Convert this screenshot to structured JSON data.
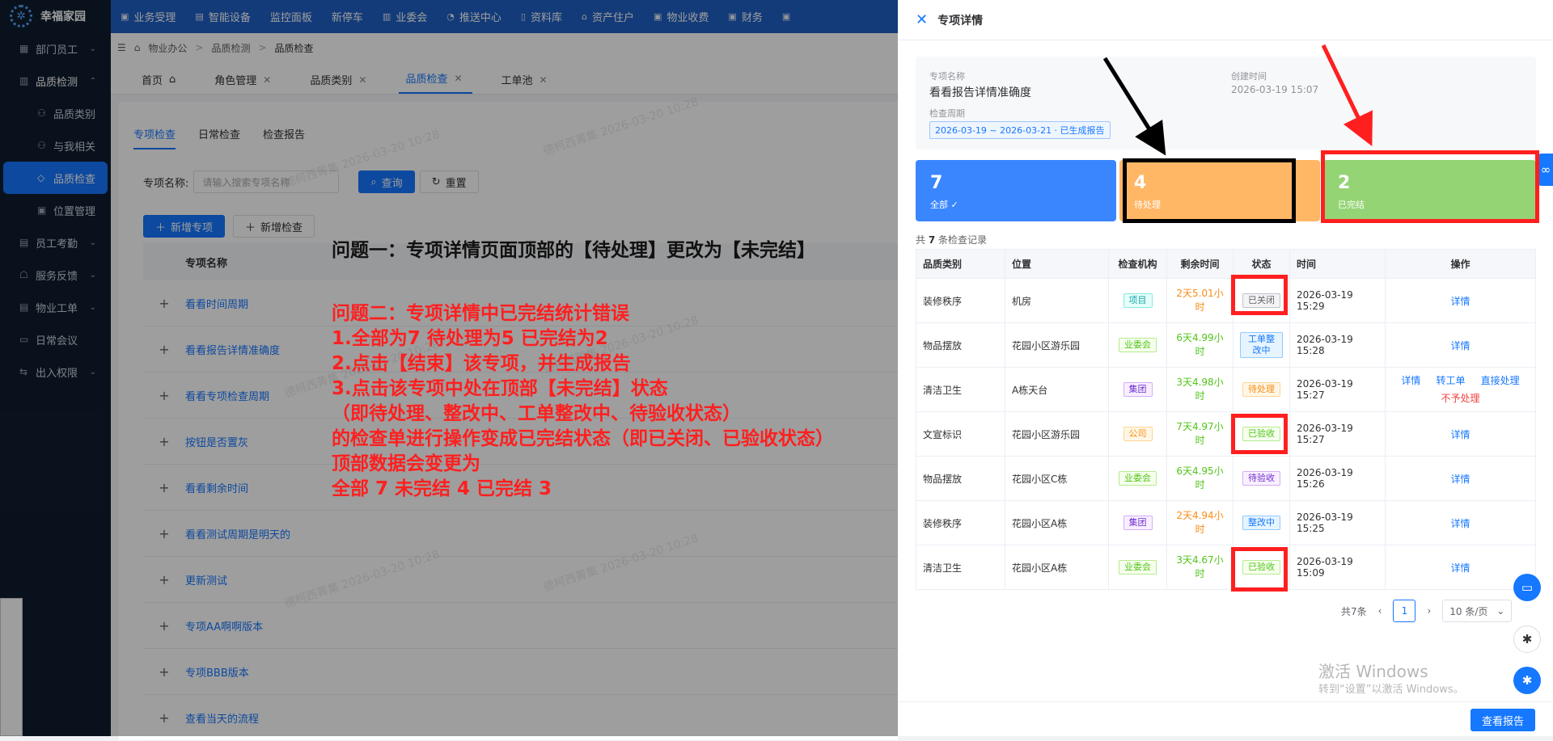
{
  "app": {
    "name": "幸福家园"
  },
  "sidebar": {
    "items": [
      {
        "icon": "department-icon",
        "label": "部门员工",
        "chev": "⌄"
      },
      {
        "icon": "quality-icon",
        "label": "品质检测",
        "chev": "⌃"
      },
      {
        "icon": "category-icon",
        "label": "品质类别"
      },
      {
        "icon": "related-icon",
        "label": "与我相关"
      },
      {
        "icon": "inspection-icon",
        "label": "品质检查"
      },
      {
        "icon": "location-icon",
        "label": "位置管理"
      },
      {
        "icon": "attendance-icon",
        "label": "员工考勤",
        "chev": "⌄"
      },
      {
        "icon": "feedback-icon",
        "label": "服务反馈",
        "chev": "⌄"
      },
      {
        "icon": "workorder-icon",
        "label": "物业工单",
        "chev": "⌄"
      },
      {
        "icon": "meeting-icon",
        "label": "日常会议"
      },
      {
        "icon": "access-icon",
        "label": "出入权限",
        "chev": "⌄"
      }
    ]
  },
  "topnav": [
    "业务受理",
    "智能设备",
    "监控面板",
    "新停车",
    "业委会",
    "推送中心",
    "资料库",
    "资产住户",
    "物业收费",
    "财务"
  ],
  "breadcrumb": [
    "物业办公",
    "品质检测",
    "品质检查"
  ],
  "tabs": [
    {
      "label": "首页"
    },
    {
      "label": "角色管理"
    },
    {
      "label": "品质类别"
    },
    {
      "label": "品质检查"
    },
    {
      "label": "工单池"
    }
  ],
  "main": {
    "subtabs": [
      "专项检查",
      "日常检查",
      "检查报告"
    ],
    "search_label": "专项名称:",
    "search_placeholder": "请输入搜索专项名称",
    "query": "查询",
    "reset": "重置",
    "add_special": "新增专项",
    "add_check": "新增检查",
    "col_name": "专项名称",
    "rows": [
      "看看时间周期",
      "看看报告详情准确度",
      "看看专项检查周期",
      "按钮是否置灰",
      "看看剩余时间",
      "看看测试周期是明天的",
      "更新测试",
      "专项AA啊啊版本",
      "专项BBB版本",
      "查看当天的流程"
    ],
    "watermark": "德柯西菁集 2026-03-20 10:28"
  },
  "annotation": {
    "black": "问题一：专项详情页面顶部的【待处理】更改为【未完结】",
    "red": [
      "问题二：专项详情中已完结统计错误",
      "1.全部为7   待处理为5    已完结为2",
      "2.点击【结束】该专项，并生成报告",
      "3.点击该专项中处在顶部【未完结】状态",
      "（即待处理、整改中、工单整改中、待验收状态）",
      "的检查单进行操作变成已完结状态（即已关闭、已验收状态）",
      "顶部数据会变更为",
      "全部 7      未完结 4      已完结  3"
    ]
  },
  "drawer": {
    "title": "专项详情",
    "name_label": "专项名称",
    "name": "看看报告详情准确度",
    "created_label": "创建时间",
    "created": "2026-03-19 15:07",
    "period_label": "检查周期",
    "period": "2026-03-19 ~ 2026-03-21 · 已生成报告",
    "stats": [
      {
        "n": "7",
        "label": "全部 ✓"
      },
      {
        "n": "4",
        "label": "待处理"
      },
      {
        "n": "2",
        "label": "已完结"
      }
    ],
    "record_count_pre": "共",
    "record_count": "7",
    "record_count_post": "条检查记录",
    "columns": [
      "品质类别",
      "位置",
      "检查机构",
      "剩余时间",
      "状态",
      "时间",
      "操作"
    ],
    "rows": [
      {
        "cat": "装修秩序",
        "loc": "机房",
        "org": "项目",
        "rem": "2天5.01小时",
        "status": "已关闭",
        "time": "2026-03-19 15:29"
      },
      {
        "cat": "物品摆放",
        "loc": "花园小区游乐园",
        "org": "业委会",
        "rem": "6天4.99小时",
        "status": "工单整改中",
        "time": "2026-03-19 15:28"
      },
      {
        "cat": "清洁卫生",
        "loc": "A栋天台",
        "org": "集团",
        "rem": "3天4.98小时",
        "status": "待处理",
        "time": "2026-03-19 15:27"
      },
      {
        "cat": "文宣标识",
        "loc": "花园小区游乐园",
        "org": "公司",
        "rem": "7天4.97小时",
        "status": "已验收",
        "time": "2026-03-19 15:27"
      },
      {
        "cat": "物品摆放",
        "loc": "花园小区C栋",
        "org": "业委会",
        "rem": "6天4.95小时",
        "status": "待验收",
        "time": "2026-03-19 15:26"
      },
      {
        "cat": "装修秩序",
        "loc": "花园小区A栋",
        "org": "集团",
        "rem": "2天4.94小时",
        "status": "整改中",
        "time": "2026-03-19 15:25"
      },
      {
        "cat": "清洁卫生",
        "loc": "花园小区A栋",
        "org": "业委会",
        "rem": "3天4.67小时",
        "status": "已验收",
        "time": "2026-03-19 15:09"
      }
    ],
    "op_detail": "详情",
    "op_transfer": "转工单",
    "op_direct": "直接处理",
    "op_reject": "不予处理",
    "total": "共7条",
    "page": "1",
    "page_size": "10 条/页",
    "activate1": "激活 Windows",
    "activate2": "转到“设置”以激活 Windows。",
    "report_btn": "查看报告"
  },
  "colors": {
    "primary": "#1677ff",
    "annotation_red": "#ff1f1f"
  }
}
